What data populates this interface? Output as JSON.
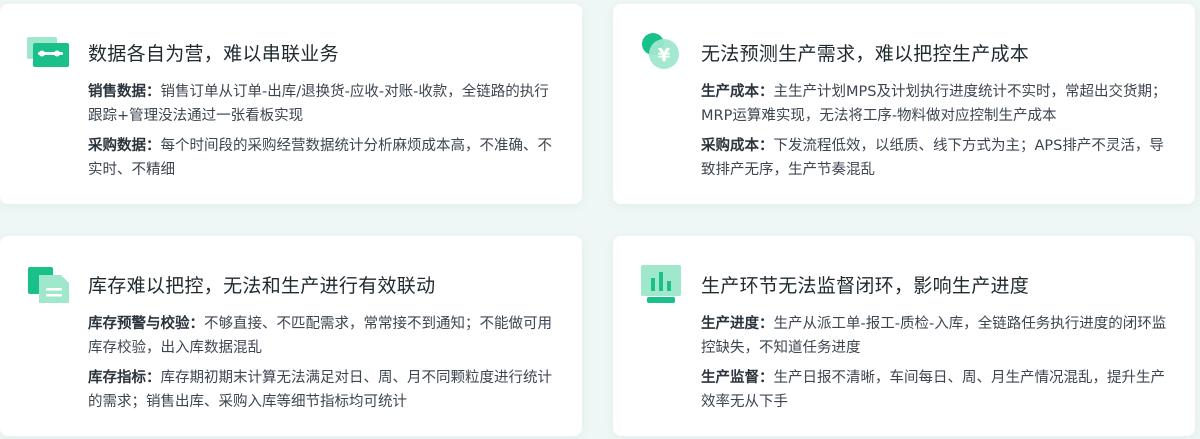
{
  "cards": [
    {
      "title": "数据各自为营，难以串联业务",
      "items": [
        {
          "label": "销售数据：",
          "text": "销售订单从订单-出库/退换货-应收-对账-收款，全链路的执行跟踪+管理没法通过一张看板实现"
        },
        {
          "label": "采购数据：",
          "text": "每个时间段的采购经营数据统计分析麻烦成本高，不准确、不实时、不精细"
        }
      ]
    },
    {
      "title": "无法预测生产需求，难以把控生产成本",
      "icon_glyph": "¥",
      "items": [
        {
          "label": "生产成本：",
          "text": "主生产计划MPS及计划执行进度统计不实时，常超出交货期；MRP运算难实现，无法将工序-物料做对应控制生产成本"
        },
        {
          "label": "采购成本：",
          "text": "下发流程低效，以纸质、线下方式为主；APS排产不灵活，导致排产无序，生产节奏混乱"
        }
      ]
    },
    {
      "title": "库存难以把控，无法和生产进行有效联动",
      "items": [
        {
          "label": "库存预警与校验：",
          "text": "不够直接、不匹配需求，常常接不到通知；不能做可用库存校验，出入库数据混乱"
        },
        {
          "label": "库存指标：",
          "text": "库存期初期末计算无法满足对日、周、月不同颗粒度进行统计的需求；销售出库、采购入库等细节指标均可统计"
        }
      ]
    },
    {
      "title": "生产环节无法监督闭环，影响生产进度",
      "items": [
        {
          "label": "生产进度：",
          "text": "生产从派工单-报工-质检-入库，全链路任务执行进度的闭环监控缺失，不知道任务进度"
        },
        {
          "label": "生产监督：",
          "text": "生产日报不清晰，车间每日、周、月生产情况混乱，提升生产效率无从下手"
        }
      ]
    }
  ],
  "colors": {
    "accent": "#19c08a",
    "accent_light": "#9fe8cc",
    "background": "#eef7f5",
    "card": "#ffffff"
  },
  "icons": [
    "data-board-icon",
    "yen-coin-icon",
    "inventory-doc-icon",
    "monitor-chart-icon"
  ]
}
